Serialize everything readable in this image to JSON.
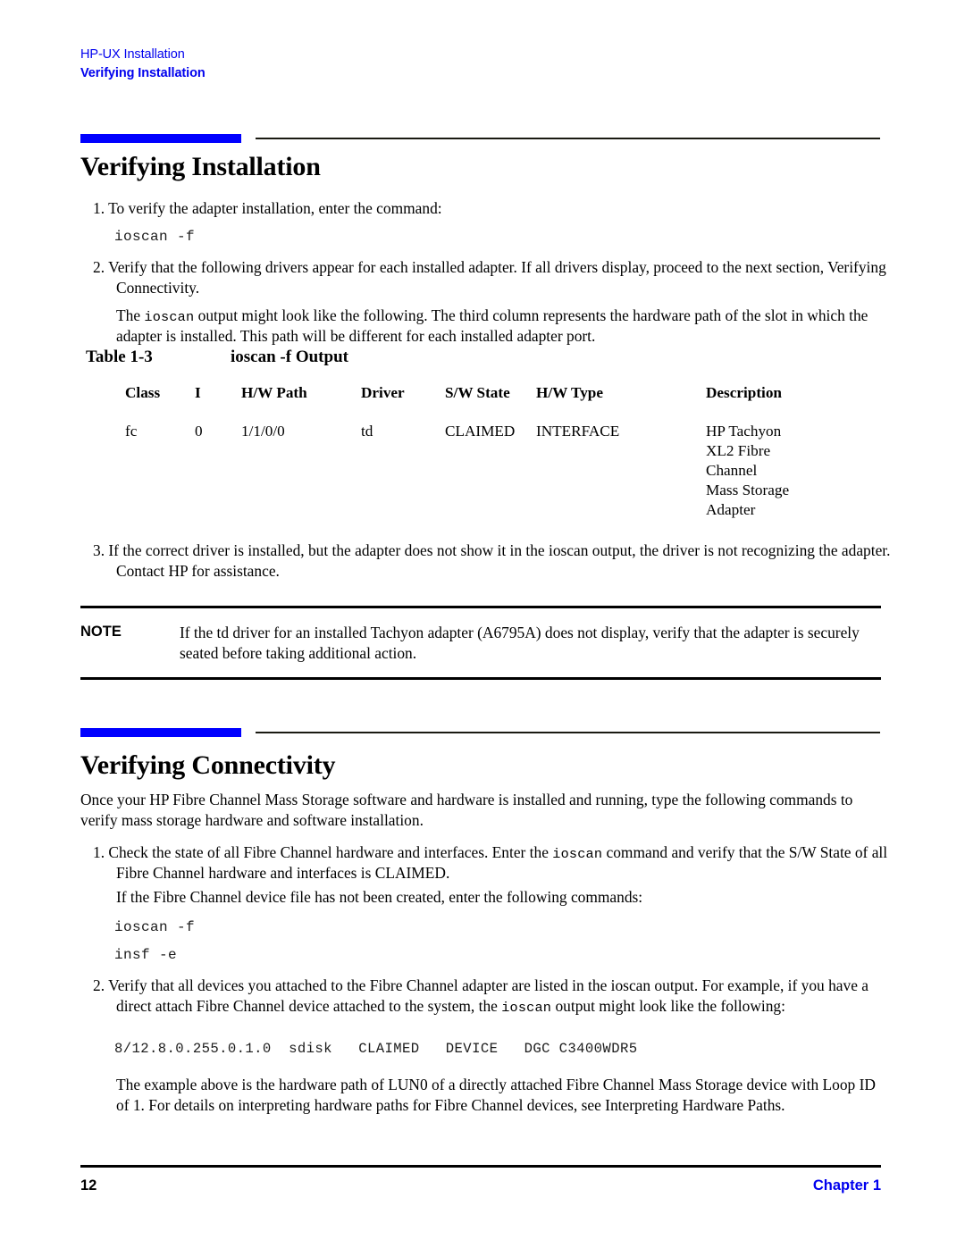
{
  "colors": {
    "accent_blue": "#0000ff",
    "link_blue": "#0000ee",
    "rule_black": "#000000"
  },
  "running_header": {
    "book_title": "HP-UX Installation",
    "section_title": "Verifying Installation"
  },
  "sections": [
    {
      "heading": "Verifying Installation",
      "items": {
        "step1": "1. To verify the adapter installation, enter the command:",
        "code1": "ioscan -f",
        "step2_line": "2. Verify that the following drivers appear for each installed adapter. If all drivers display, proceed to the next section, Verifying Connectivity.",
        "para_intro_a": "The ",
        "para_intro_mono": "ioscan",
        "para_intro_b": " output might look like the following. The third column represents the hardware path of the slot in which the adapter is installed. This path will be different for each installed adapter port.",
        "step3": "3. If the correct driver is installed, but the adapter does not show it in the ioscan output, the driver is not recognizing the adapter. Contact HP for assistance."
      }
    },
    {
      "heading": "Verifying Connectivity",
      "items": {
        "intro": "Once your HP Fibre Channel Mass Storage software and hardware is installed and running, type the following commands to verify mass storage hardware and software installation.",
        "step1_a": "1. Check the state of all Fibre Channel hardware and interfaces. Enter the ",
        "step1_mono": "ioscan",
        "step1_b": " command and verify that the S/W State of all Fibre Channel hardware and interfaces is CLAIMED.",
        "para_devfile": "If the Fibre Channel device file has not been created, enter the following commands:",
        "code_ioscan": "ioscan -f",
        "code_insf": "insf -e",
        "step2_a": "2. Verify that all devices you attached to the Fibre Channel adapter are listed in the ioscan output. For example, if you have a direct attach Fibre Channel device attached to the system, the ",
        "step2_mono": "ioscan",
        "step2_b": " output might look like the following:",
        "code_output": "8/12.8.0.255.0.1.0  sdisk   CLAIMED   DEVICE   DGC C3400WDR5",
        "para_closing": "The example above is the hardware path of LUN0 of a directly attached Fibre Channel Mass Storage device with Loop ID of 1. For details on interpreting hardware paths for Fibre Channel devices, see Interpreting Hardware Paths."
      }
    }
  ],
  "table": {
    "caption_number": "Table 1-3",
    "caption_title": "ioscan -f Output",
    "columns": [
      "Class",
      "I",
      "H/W Path",
      "Driver",
      "S/W State",
      "H/W Type",
      "Description"
    ],
    "rows": [
      {
        "class": "fc",
        "i": "0",
        "hw_path": "1/1/0/0",
        "driver": "td",
        "sw_state": "CLAIMED",
        "hw_type": "INTERFACE",
        "description_lines": [
          "HP Tachyon",
          "XL2 Fibre",
          "Channel",
          "Mass Storage",
          "Adapter"
        ]
      }
    ]
  },
  "note": {
    "label": "NOTE",
    "text": "If the td driver for an installed Tachyon adapter (A6795A) does not display, verify that the adapter is securely seated before taking additional action."
  },
  "footer": {
    "page_number": "12",
    "chapter": "Chapter 1"
  }
}
